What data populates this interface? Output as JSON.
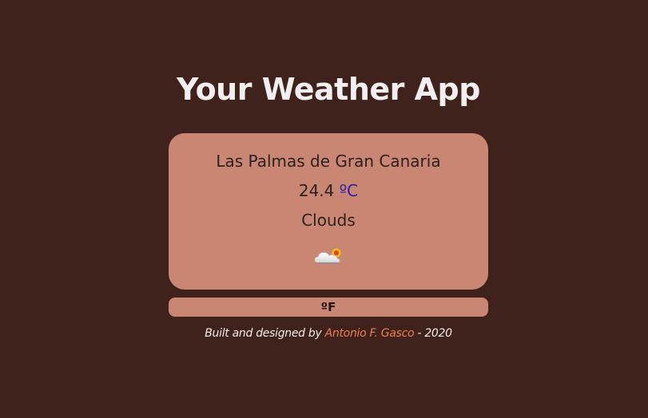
{
  "app": {
    "title": "Your Weather App"
  },
  "weather": {
    "city": "Las Palmas de Gran Canaria",
    "temperature": "24.4",
    "unit_label": "ºC",
    "condition": "Clouds",
    "icon": "cloud-sun-icon"
  },
  "toggle": {
    "label": "ºF"
  },
  "footer": {
    "prefix": "Built and designed by ",
    "author": "Antonio F. Gasco",
    "suffix": " - 2020"
  },
  "colors": {
    "background": "#3f221c",
    "card": "#c98672",
    "unit_link": "#2a1fa8",
    "author_link": "#f07f52"
  }
}
